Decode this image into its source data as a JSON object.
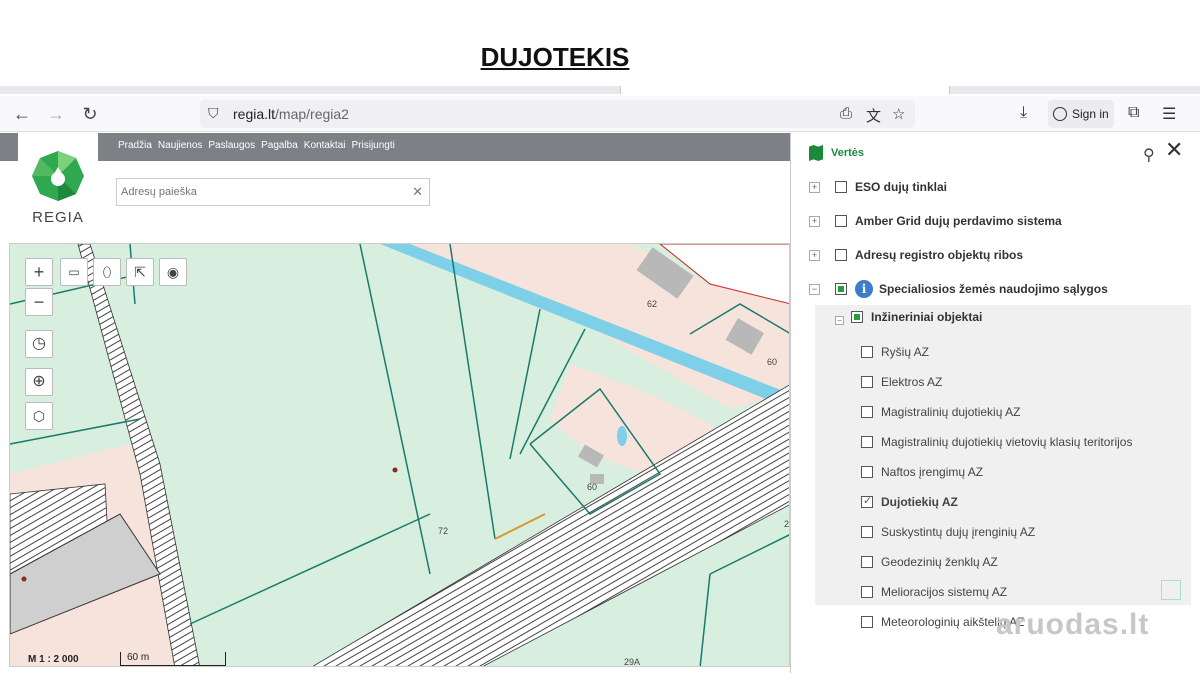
{
  "slide": {
    "title": "DUJOTEKIS"
  },
  "browser": {
    "url_domain": "regia.lt",
    "url_path": "/map/regia2",
    "signin_label": "Sign in",
    "icons": [
      "back-arrow-icon",
      "forward-arrow-icon",
      "reload-icon",
      "shield-icon",
      "download-page-icon",
      "translate-icon",
      "star-icon",
      "download-icon",
      "account-icon",
      "extensions-icon",
      "menu-icon"
    ]
  },
  "regia": {
    "logo_text": "REGIA",
    "menu": [
      "Pradžia",
      "Naujienos",
      "Paslaugos",
      "Pagalba",
      "Kontaktai",
      "Prisijungti"
    ],
    "search_placeholder": "Adresų paieška"
  },
  "map": {
    "scale_text": "M 1 : 2 000",
    "scale_bar_label": "60 m",
    "parcel_labels": [
      "62",
      "60",
      "60",
      "72",
      "29A",
      "2"
    ],
    "colors": {
      "land": "#d8efe0",
      "pink": "#f6e3dc",
      "blue_strip": "#7dd0e8",
      "parcel_line": "#1a7a6a",
      "red_line": "#cc2222"
    }
  },
  "panel": {
    "title": "Vertės",
    "layers": [
      {
        "label": "ESO dujų tinklai",
        "bold": true
      },
      {
        "label": "Amber Grid dujų perdavimo sistema",
        "bold": true
      },
      {
        "label": "Adresų registro objektų ribos",
        "bold": true
      },
      {
        "label": "Specialiosios žemės naudojimo sąlygos",
        "bold": true
      }
    ],
    "sub_group": "Inžineriniai objektai",
    "sub_items": [
      {
        "label": "Ryšių AZ",
        "checked": false
      },
      {
        "label": "Elektros AZ",
        "checked": false
      },
      {
        "label": "Magistralinių dujotiekių AZ",
        "checked": false
      },
      {
        "label": "Magistralinių dujotiekių vietovių klasių teritorijos",
        "checked": false
      },
      {
        "label": "Naftos įrengimų AZ",
        "checked": false
      },
      {
        "label": "Dujotiekių AZ",
        "checked": true
      },
      {
        "label": "Suskystintų dujų įrenginių AZ",
        "checked": false
      },
      {
        "label": "Geodezinių ženklų AZ",
        "checked": false
      },
      {
        "label": "Melioracijos sistemų AZ",
        "checked": false
      },
      {
        "label": "Meteorologinių aikštelių AZ",
        "checked": false
      }
    ]
  },
  "watermark": "aruodas.lt"
}
